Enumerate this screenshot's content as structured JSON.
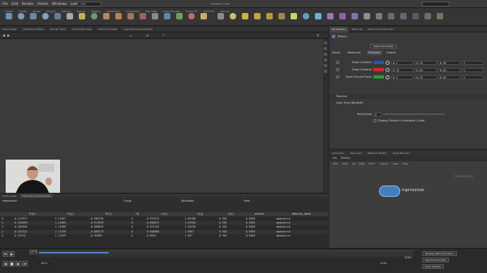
{
  "menus": [
    "File",
    "Edit",
    "Render",
    "Assets",
    "Windows",
    "Labs",
    "Help"
  ],
  "desktop": "Light",
  "window_title": "Houdini Core",
  "shelf_tabs": [
    "Create",
    "Modify",
    "Model",
    "Polygon",
    "Deform",
    "Texture",
    "Rigging",
    "Characters",
    "Constraints",
    "Hair Utils",
    "Guide Process",
    "Terrain FX",
    "Cloud FX",
    "Volume"
  ],
  "viewer_tabs": [
    "Scene View",
    "Animation Editor",
    "Render View",
    "Composite View",
    "Motion FX View",
    "Geometry Spreadsheet"
  ],
  "param_tabs": [
    "Parameters",
    "Take List",
    "Performance Monitor"
  ],
  "param": {
    "node_name": "Beauty",
    "create_btn": "Reset Simulation",
    "sections": [
      "Solver",
      "Advanced",
      "Emission",
      "Output"
    ],
    "rows": [
      {
        "label": "Show Colliders",
        "color": "#1f56b8",
        "values": [
          "0.1",
          "0.33",
          "0.95",
          "1"
        ]
      },
      {
        "label": "Show Contacts",
        "color": "#d42a2a",
        "values": [
          "0.25",
          "0.04",
          "0.04",
          "1"
        ]
      },
      {
        "label": "Show Ground Plane",
        "color": "#2e9a3a",
        "values": [
          "0.4",
          "0.25",
          "0.04",
          "1"
        ]
      }
    ],
    "particle_section": "Particles",
    "point_scale_label": "Point Scale",
    "point_scale": "0",
    "color_label": "Color From Attribute",
    "pf_label": "Display Pinned in Animation Guide"
  },
  "network": {
    "tabs": [
      "Geometry",
      "Tree View",
      "Material Palette",
      "Asset Browser"
    ],
    "path": [
      "obj",
      "Beauty"
    ],
    "bar_items": [
      "Add",
      "Edit",
      "Go",
      "View",
      "Tools",
      "Layout",
      "Labs",
      "Help"
    ],
    "node_name": "mpmsolver",
    "context_label": "Geometry"
  },
  "spreadsheet": {
    "node": "mpmsolver",
    "group": "Group",
    "attrib_label": "Attributes",
    "view_label": "View",
    "headers": [
      "",
      "P[x]",
      "P[y]",
      "P[z]",
      "Cd",
      "v[x]",
      "v[y]",
      "v[z]",
      "pscale",
      "density_mask",
      "ptnum"
    ],
    "rows": [
      [
        "0",
        "-0.372974",
        "1.11817",
        "-0.905796",
        "0",
        "0.973573",
        "1.65168",
        "0.926",
        "0.0509",
        "mpmsource"
      ],
      [
        "1",
        "-0.336099",
        "1.14655",
        "-0.913978",
        "0",
        "0.966037",
        "1.67958",
        "0.926",
        "0.0509",
        "mpmsource"
      ],
      [
        "2",
        "-0.365046",
        "1.15409",
        "-0.868076",
        "0",
        "0.973154",
        "1.63258",
        "0.926",
        "0.0509",
        "mpmsource"
      ],
      [
        "3",
        "-0.351522",
        "1.11299",
        "-0.866779",
        "0",
        "0.900868",
        "1.6967",
        "0.926",
        "0.0509",
        "mpmsource"
      ],
      [
        "4",
        "-0.33152",
        "1.11079",
        "-0.92096",
        "0",
        "0.9824",
        "1.657",
        "0.926",
        "0.0509",
        "mpmsource"
      ]
    ]
  },
  "playbar": {
    "frame": "1000",
    "start": "1001",
    "end": "1240",
    "range_end": "1240",
    "key_label": "Auto Update",
    "extra_labels": [
      "Display Path Animation",
      "Key All Channels",
      "Auto Update"
    ]
  },
  "colors": {
    "node": "#3f7fbf",
    "accent": "#4a7ec8"
  }
}
